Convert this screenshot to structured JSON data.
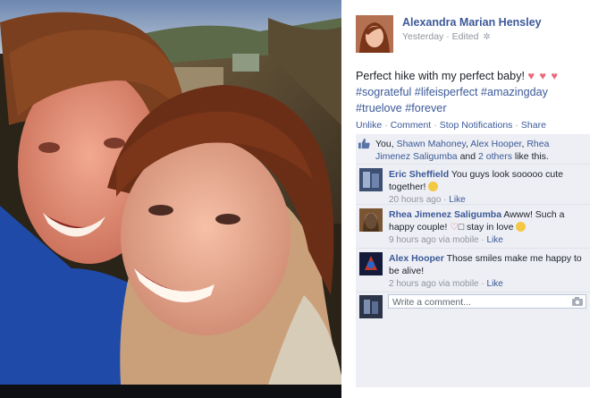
{
  "post": {
    "author": "Alexandra Marian Hensley",
    "timestamp": "Yesterday",
    "edited": "Edited",
    "text": "Perfect hike with my perfect baby!",
    "hearts": "♥ ♥ ♥",
    "hashtags": "#sograteful #lifeisperfect #amazingday #truelove #forever"
  },
  "actions": {
    "unlike": "Unlike",
    "comment": "Comment",
    "stop_notifications": "Stop Notifications",
    "share": "Share"
  },
  "likes": {
    "you": "You,",
    "name1": "Shawn Mahoney",
    "name2": "Alex Hooper",
    "name3": "Rhea Jimenez Saligumba",
    "and": "and",
    "others": "2 others",
    "tail": "like this."
  },
  "comments": [
    {
      "name": "Eric Sheffield",
      "text": "You guys look sooooo cute together!",
      "time": "20 hours ago",
      "like": "Like"
    },
    {
      "name": "Rhea Jimenez Saligumba",
      "text_a": "Awww! Such a happy couple!",
      "text_b": "stay in love",
      "time": "9 hours ago via mobile",
      "like": "Like"
    },
    {
      "name": "Alex Hooper",
      "text": "Those smiles make me happy to be alive!",
      "time": "2 hours ago via mobile",
      "like": "Like"
    }
  ],
  "write_comment": {
    "placeholder": "Write a comment..."
  },
  "icons": [
    "gear-icon",
    "like-thumb-icon",
    "camera-icon",
    "heart-icon",
    "smiley-icon"
  ],
  "colors": {
    "link": "#3b5998",
    "meta": "#90949c",
    "ufi_bg": "#edeff4",
    "heart": "#e9697a"
  }
}
